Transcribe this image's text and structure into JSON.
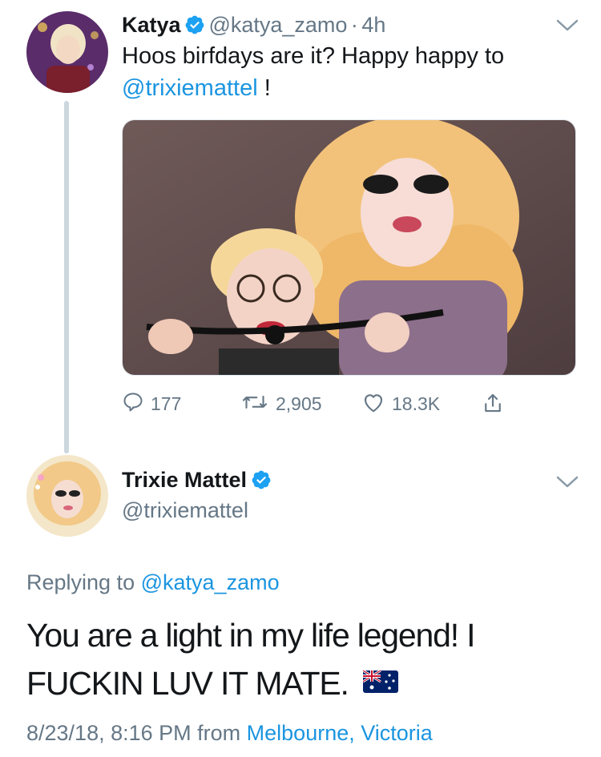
{
  "tweet1": {
    "name": "Katya",
    "handle": "@katya_zamo",
    "separator": "·",
    "time": "4h",
    "text_line1": "Hoos birfdays are it? Happy happy to",
    "mention": "@trixiemattel",
    "text_end": " !",
    "actions": {
      "replies": "177",
      "retweets": "2,905",
      "likes": "18.3K"
    }
  },
  "tweet2": {
    "name": "Trixie Mattel",
    "handle": "@trixiemattel",
    "replying_prefix": "Replying to",
    "replying_handle": "@katya_zamo",
    "text_line1": "You are a light in my life legend! I",
    "text_line2": "FUCKIN LUV IT MATE.",
    "date": "8/23/18, 8:16 PM from",
    "location": "Melbourne, Victoria"
  },
  "colors": {
    "link": "#1b95e0",
    "secondary": "#657786",
    "verified": "#1da1f2"
  }
}
